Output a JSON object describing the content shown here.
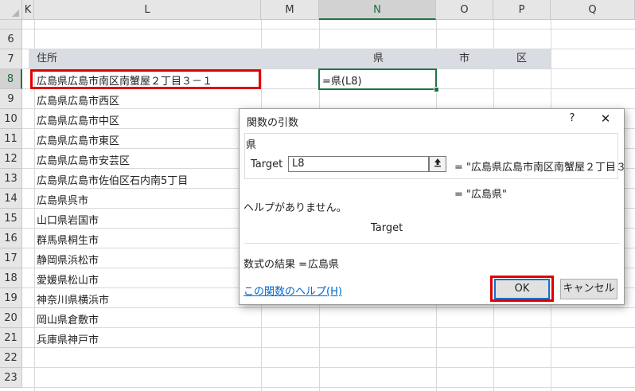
{
  "columns": [
    {
      "id": "K",
      "label": "K"
    },
    {
      "id": "L",
      "label": "L"
    },
    {
      "id": "M",
      "label": "M"
    },
    {
      "id": "N",
      "label": "N"
    },
    {
      "id": "O",
      "label": "O"
    },
    {
      "id": "P",
      "label": "P"
    },
    {
      "id": "Q",
      "label": "Q"
    }
  ],
  "rows": [
    "6",
    "7",
    "8",
    "9",
    "10",
    "11",
    "12",
    "13",
    "14",
    "15",
    "16",
    "17",
    "18",
    "19",
    "20",
    "21",
    "22",
    "23"
  ],
  "header_row": {
    "address": "住所",
    "pref": "県",
    "city": "市",
    "ward": "区"
  },
  "addresses": [
    "広島県広島市南区南蟹屋２丁目３－１",
    "広島県広島市西区",
    "広島県広島市中区",
    "広島県広島市東区",
    "広島県広島市安芸区",
    "広島県広島市佐伯区石内南5丁目",
    "広島県呉市",
    "山口県岩国市",
    "群馬県桐生市",
    "静岡県浜松市",
    "愛媛県松山市",
    "神奈川県横浜市",
    "岡山県倉敷市",
    "兵庫県神戸市"
  ],
  "active_cell_formula": "=県(L8)",
  "dialog": {
    "title": "関数の引数",
    "help_glyph": "?",
    "close_glyph": "✕",
    "function_name": "県",
    "arg_label": "Target",
    "arg_value": "L8",
    "arg_result": "=  \"広島県広島市南区南蟹屋２丁目３",
    "func_result": "=  \"広島県\"",
    "no_help": "ヘルプがありません。",
    "arg_desc": "Target",
    "formula_result_label": "数式の結果 =",
    "formula_result_value": "広島県",
    "help_link": "この関数のヘルプ(H)",
    "ok_label": "OK",
    "cancel_label": "キャンセル"
  }
}
